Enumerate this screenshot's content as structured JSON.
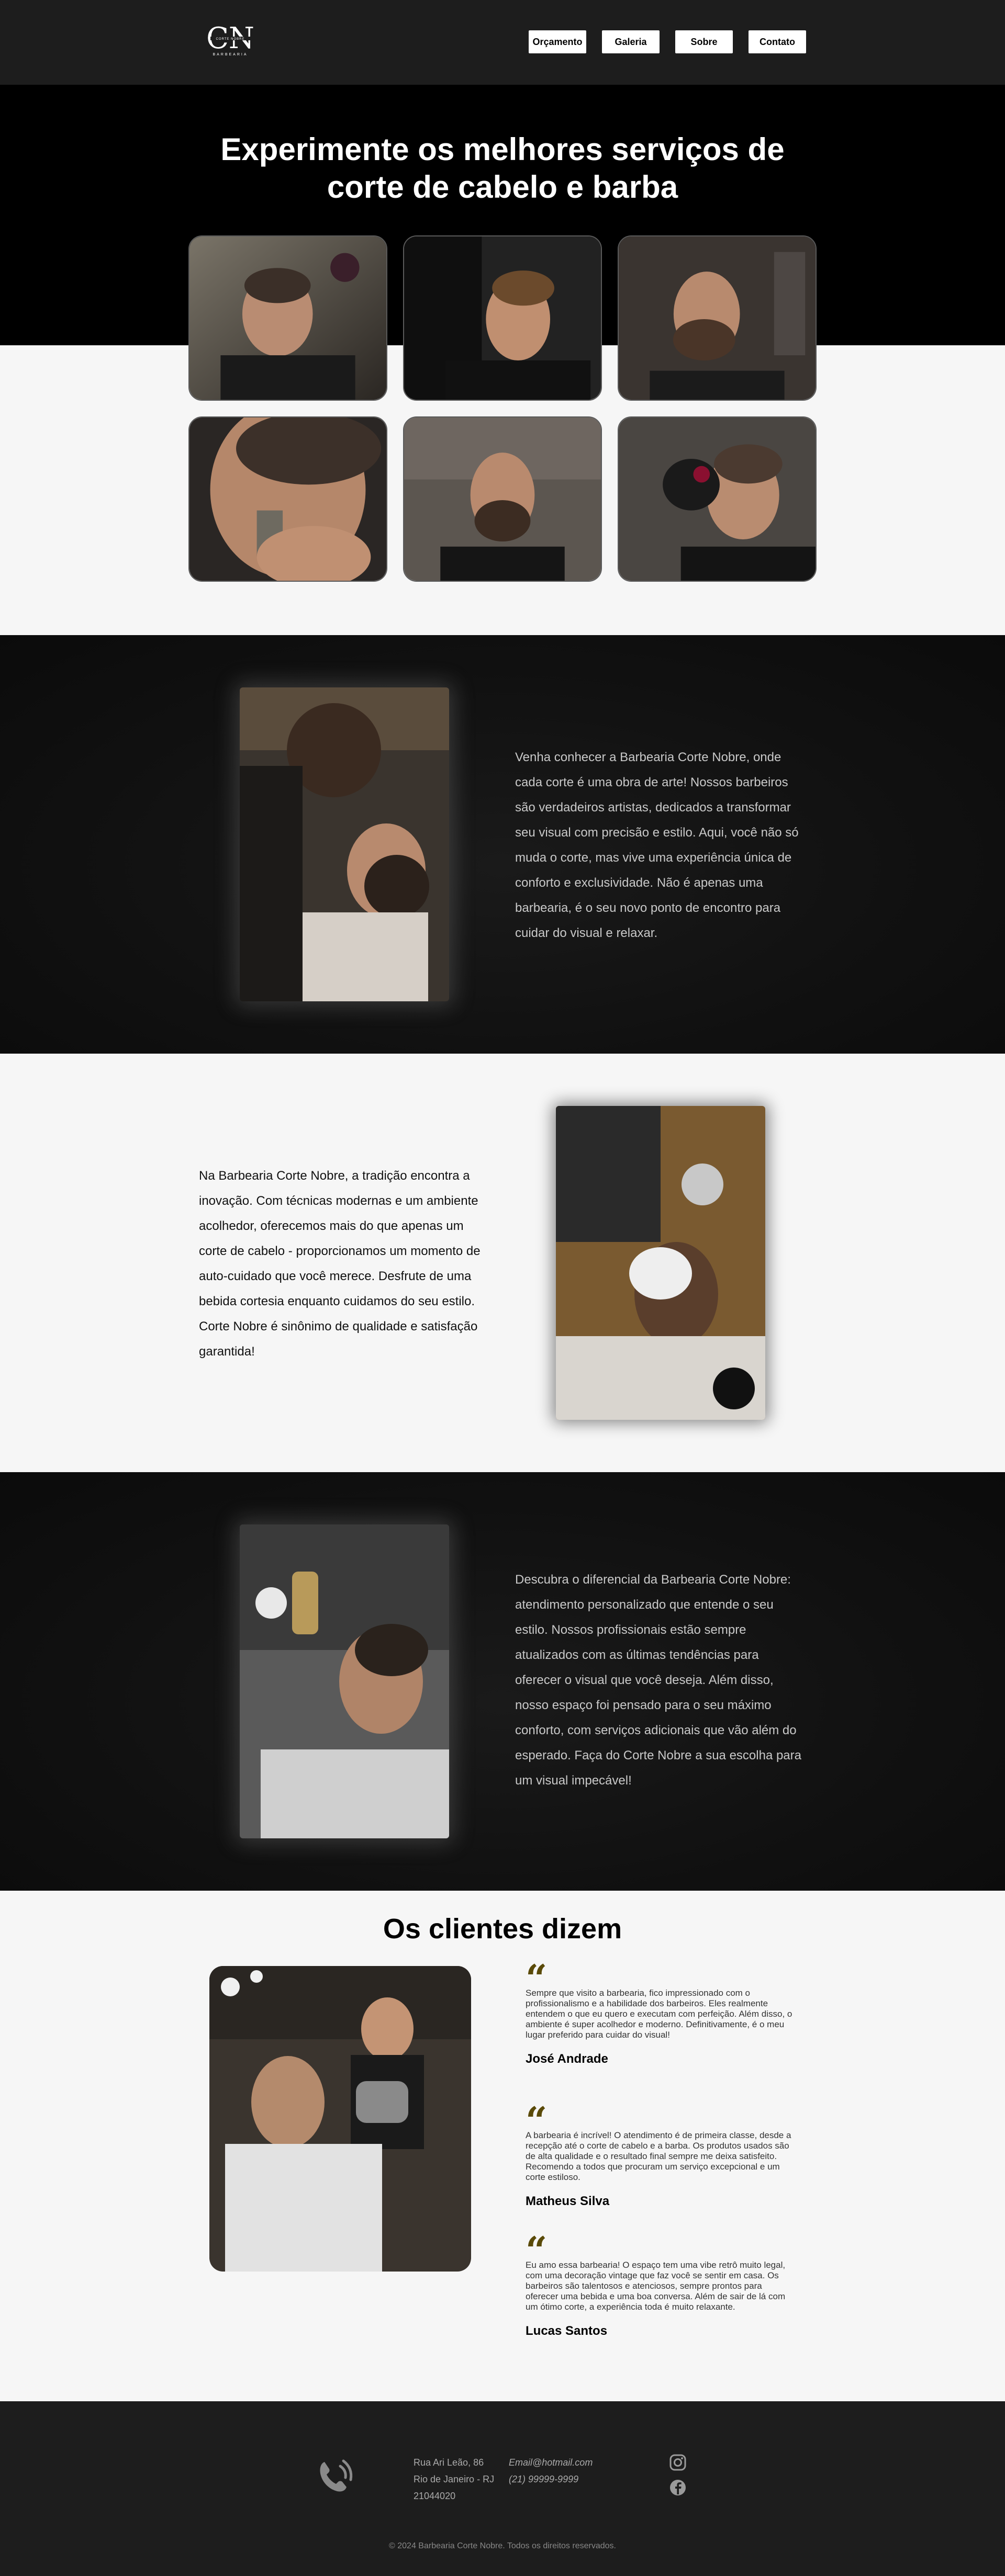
{
  "header": {
    "logo": {
      "monogram": "CN",
      "small_text_top": "CORTE NOBRE",
      "small_text_bottom": "BARBEARIA"
    },
    "nav": [
      {
        "label": "Orçamento"
      },
      {
        "label": "Galeria"
      },
      {
        "label": "Sobre"
      },
      {
        "label": "Contato"
      }
    ]
  },
  "hero": {
    "title_line1": "Experimente os melhores serviços de",
    "title_line2": "corte de cabelo e barba"
  },
  "about": [
    {
      "text": "Venha conhecer a Barbearia Corte Nobre, onde cada corte é uma obra de arte! Nossos barbeiros são verdadeiros artistas, dedicados a transformar seu visual com precisão e estilo. Aqui, você não só muda o corte, mas vive uma experiência única de conforto e exclusividade. Não é apenas uma barbearia, é o seu novo ponto de encontro para cuidar do visual e relaxar."
    },
    {
      "text": "Na Barbearia Corte Nobre, a tradição encontra a inovação. Com técnicas modernas e um ambiente acolhedor, oferecemos mais do que apenas um corte de cabelo - proporcionamos um momento de auto-cuidado que você merece. Desfrute de uma bebida cortesia enquanto cuidamos do seu estilo. Corte Nobre é sinônimo de qualidade e satisfação garantida!"
    },
    {
      "text": "Descubra o diferencial da Barbearia Corte Nobre: atendimento personalizado que entende o seu estilo. Nossos profissionais estão sempre atualizados com as últimas tendências para oferecer o visual que você deseja. Além disso, nosso espaço foi pensado para o seu máximo conforto, com serviços adicionais que vão além do esperado. Faça do Corte Nobre a sua escolha para um visual impecável!"
    }
  ],
  "testimonials": {
    "title": "Os clientes dizem",
    "items": [
      {
        "text": "Sempre que visito a barbearia, fico impressionado com o profissionalismo e a habilidade dos barbeiros. Eles realmente entendem o que eu quero e executam com perfeição. Além disso, o ambiente é super acolhedor e moderno. Definitivamente, é o meu lugar preferido para cuidar do visual!",
        "name": "José Andrade"
      },
      {
        "text": "A barbearia é incrível! O atendimento é de primeira classe, desde a recepção até o corte de cabelo e a barba. Os produtos usados são de alta qualidade e o resultado final sempre me deixa satisfeito. Recomendo a todos que procuram um serviço excepcional e um corte estiloso.",
        "name": "Matheus Silva"
      },
      {
        "text": "Eu amo essa barbearia! O espaço tem uma vibe retrô muito legal, com uma decoração vintage que faz você se sentir em casa. Os barbeiros são talentosos e atenciosos, sempre prontos para oferecer uma bebida e uma boa conversa. Além de sair de lá com um ótimo corte, a experiência toda é muito relaxante.",
        "name": "Lucas Santos"
      }
    ]
  },
  "footer": {
    "address_line1": "Rua Ari Leão, 86",
    "address_line2": "Rio de Janeiro - RJ",
    "address_line3": "21044020",
    "email": "Email@hotmail.com",
    "phone": "(21) 99999-9999",
    "copyright": "© 2024 Barbearia Corte Nobre. Todos os direitos reservados.",
    "icons": [
      "phone-icon",
      "instagram-icon",
      "facebook-icon"
    ]
  },
  "colors": {
    "header_bg": "#1d1d1d",
    "hero_bg": "#000000",
    "page_bg": "#f6f6f6",
    "quote_accent": "#5a4a08"
  }
}
